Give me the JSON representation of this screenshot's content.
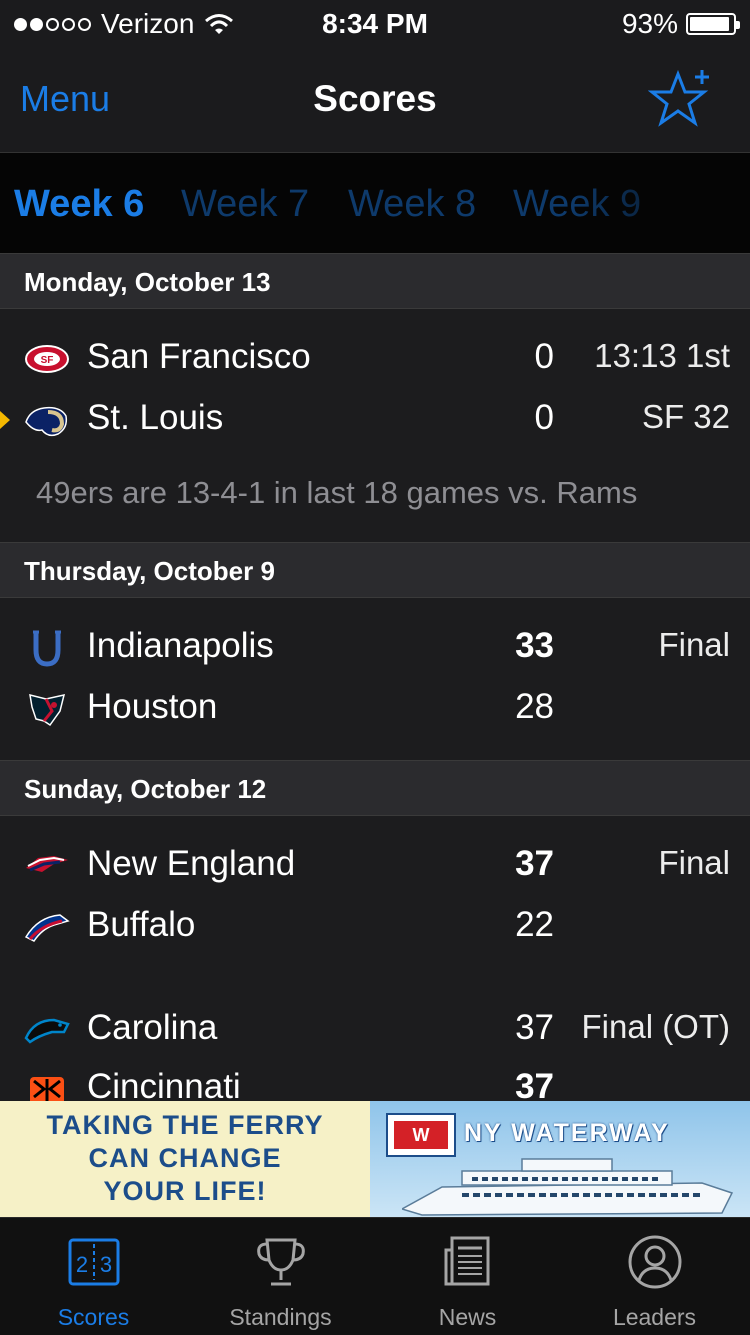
{
  "status_bar": {
    "carrier": "Verizon",
    "time": "8:34 PM",
    "battery": "93%"
  },
  "nav": {
    "menu_label": "Menu",
    "title": "Scores",
    "favorite_icon": "star-plus-icon"
  },
  "weeks": [
    {
      "label": "Week 6",
      "active": true
    },
    {
      "label": "Week 7",
      "active": false
    },
    {
      "label": "Week 8",
      "active": false
    },
    {
      "label": "Week 9",
      "active": false
    }
  ],
  "sections": [
    {
      "date": "Monday, October 13",
      "games": [
        {
          "teams": [
            {
              "name": "San Francisco",
              "score": "0",
              "status": "13:13 1st",
              "logo": "49ers-logo-icon"
            },
            {
              "name": "St. Louis",
              "score": "0",
              "status": "SF 32",
              "logo": "rams-logo-icon",
              "possession": true
            }
          ],
          "note": "49ers are 13-4-1 in last 18 games vs. Rams"
        }
      ]
    },
    {
      "date": "Thursday, October 9",
      "games": [
        {
          "teams": [
            {
              "name": "Indianapolis",
              "score": "33",
              "status": "Final",
              "winner": true,
              "logo": "colts-logo-icon"
            },
            {
              "name": "Houston",
              "score": "28",
              "status": "",
              "logo": "texans-logo-icon"
            }
          ]
        }
      ]
    },
    {
      "date": "Sunday, October 12",
      "games": [
        {
          "teams": [
            {
              "name": "New England",
              "score": "37",
              "status": "Final",
              "winner": true,
              "logo": "patriots-logo-icon"
            },
            {
              "name": "Buffalo",
              "score": "22",
              "status": "",
              "logo": "bills-logo-icon"
            }
          ]
        },
        {
          "teams": [
            {
              "name": "Carolina",
              "score": "37",
              "status": "Final (OT)",
              "logo": "panthers-logo-icon"
            },
            {
              "name": "Cincinnati",
              "score": "37",
              "status": "",
              "logo": "bengals-logo-icon"
            }
          ]
        }
      ]
    }
  ],
  "ad": {
    "left_lines": [
      "TAKING THE FERRY",
      "CAN CHANGE",
      "YOUR LIFE!"
    ],
    "brand": "NY WATERWAY",
    "badge": "W"
  },
  "tabs": [
    {
      "label": "Scores",
      "icon": "scoreboard-icon",
      "active": true
    },
    {
      "label": "Standings",
      "icon": "trophy-icon",
      "active": false
    },
    {
      "label": "News",
      "icon": "newspaper-icon",
      "active": false
    },
    {
      "label": "Leaders",
      "icon": "person-icon",
      "active": false
    }
  ],
  "colors": {
    "accent": "#1b7de6",
    "background": "#1c1c1e",
    "header": "#2b2b2e",
    "possession": "#f5b800"
  }
}
